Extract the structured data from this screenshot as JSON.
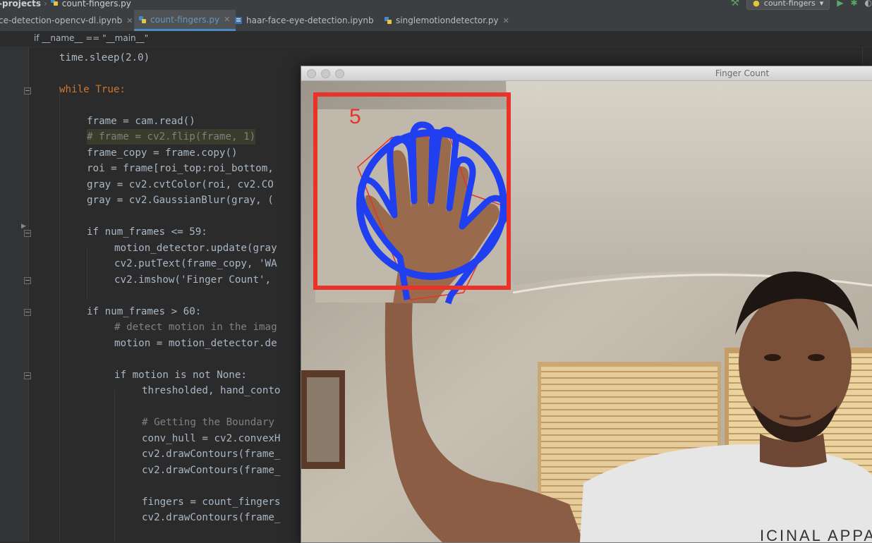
{
  "topbar": {
    "project": "-projects",
    "file": "count-fingers.py",
    "run_config": "count-fingers"
  },
  "tabs": [
    {
      "label": "ce-detection-opencv-dl.ipynb",
      "active": false
    },
    {
      "label": "count-fingers.py",
      "active": true
    },
    {
      "label": "haar-face-eye-detection.ipynb",
      "active": false
    },
    {
      "label": "singlemotiondetector.py",
      "active": false
    }
  ],
  "breadcrumb": "if __name__ == \"__main__\"",
  "code_lines": {
    "l1": "time.sleep(2.0)",
    "l2": "while True:",
    "l3": "frame = cam.read()",
    "l4": "# frame = cv2.flip(frame, 1)",
    "l5": "frame_copy = frame.copy()",
    "l6": "roi = frame[roi_top:roi_bottom,",
    "l7": "gray = cv2.cvtColor(roi, cv2.CO",
    "l8": "gray = cv2.GaussianBlur(gray, (",
    "l9": "if num_frames <= 59:",
    "l10": "motion_detector.update(gray",
    "l11": "cv2.putText(frame_copy, 'WA",
    "l12": "cv2.imshow('Finger Count',",
    "l13": "if num_frames > 60:",
    "l14": "# detect motion in the imag",
    "l15": "motion = motion_detector.de",
    "l16": "if motion is not None:",
    "l17": "thresholded, hand_conto",
    "l18": "# Getting the Boundary",
    "l19": "conv_hull = cv2.convexH",
    "l20": "cv2.drawContours(frame_",
    "l21": "cv2.drawContours(frame_",
    "l22": "fingers = count_fingers",
    "l23": "cv2.drawContours(frame_"
  },
  "window": {
    "title": "Finger Count",
    "finger_count": "5"
  },
  "colors": {
    "roi_box": "#e8322a",
    "contour": "#1f3ff0",
    "hull": "#e8322a",
    "count_text": "#e8322a"
  }
}
